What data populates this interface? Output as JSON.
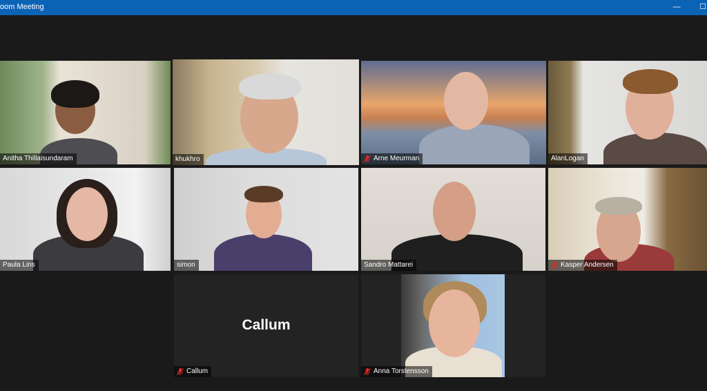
{
  "window": {
    "title": "oom Meeting",
    "minimize_glyph": "—",
    "maximize_glyph": "☐"
  },
  "colors": {
    "titlebar": "#0b63b6",
    "active_speaker_border": "#e4e86a",
    "muted_icon": "#e02828"
  },
  "participants": [
    {
      "name": "Anitha Thillaisundaram",
      "muted": false
    },
    {
      "name": "khukhro",
      "muted": false,
      "active_speaker": true
    },
    {
      "name": "Arne Meurman",
      "muted": true
    },
    {
      "name": "AlanLogan",
      "muted": false
    },
    {
      "name": "Paula Lins",
      "muted": false
    },
    {
      "name": "simon",
      "muted": false
    },
    {
      "name": "Sandro Mattarei",
      "muted": false
    },
    {
      "name": "Kasper Andersen",
      "muted": true
    },
    {
      "name": "Callum",
      "muted": true,
      "video_off": true,
      "avatar_text": "Callum"
    },
    {
      "name": "Anna Torstensson",
      "muted": true
    }
  ]
}
